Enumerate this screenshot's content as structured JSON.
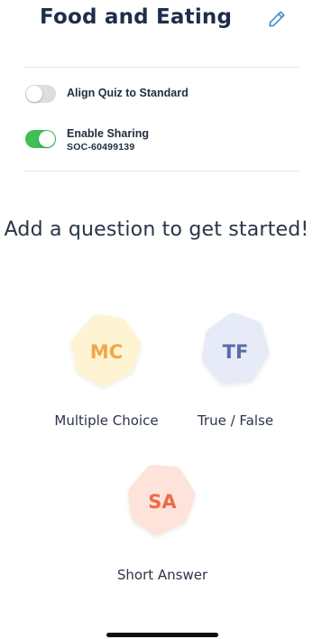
{
  "header": {
    "title": "Food and Eating",
    "edit_icon": "pencil-icon"
  },
  "settings": {
    "align_quiz": {
      "label": "Align Quiz to Standard",
      "enabled": false
    },
    "sharing": {
      "label": "Enable Sharing",
      "code": "SOC-60499139",
      "enabled": true
    }
  },
  "empty_state": {
    "prompt": "Add a question to get started!"
  },
  "question_types": [
    {
      "abbr": "MC",
      "label": "Multiple Choice",
      "color": "#f0a848",
      "fill": "#fef3d2"
    },
    {
      "abbr": "TF",
      "label": "True / False",
      "color": "#5b6aa8",
      "fill": "#e7ebf8"
    },
    {
      "abbr": "SA",
      "label": "Short Answer",
      "color": "#ef6a48",
      "fill": "#fde3da"
    }
  ],
  "colors": {
    "toggle_on": "#3fbf55",
    "toggle_off": "#dcdee3",
    "title": "#1f2d4a",
    "edit_icon": "#3d8fd6"
  }
}
